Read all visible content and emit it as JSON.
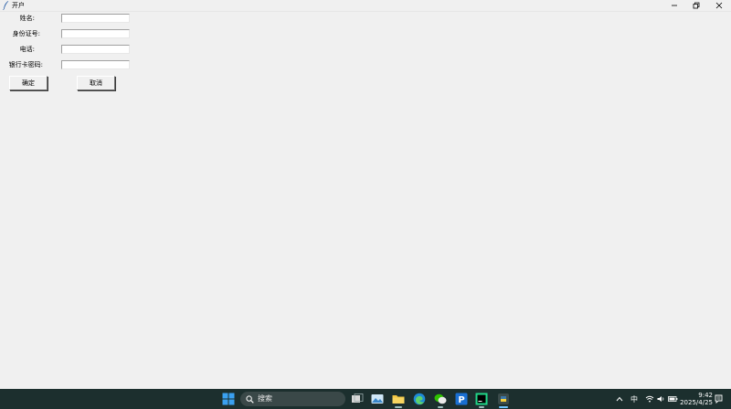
{
  "window": {
    "title": "开户"
  },
  "form": {
    "fields": [
      {
        "label": "姓名:",
        "value": "",
        "placeholder": ""
      },
      {
        "label": "身份证号:",
        "value": "",
        "placeholder": ""
      },
      {
        "label": "电话:",
        "value": "",
        "placeholder": ""
      },
      {
        "label": "银行卡密码:",
        "value": "",
        "placeholder": ""
      }
    ],
    "confirm_label": "确定",
    "cancel_label": "取消"
  },
  "taskbar": {
    "search_placeholder": "搜索",
    "ime_indicator": "中",
    "time": "9:42",
    "date": "2025/4/25",
    "apps": [
      "windows-start",
      "task-view",
      "photos",
      "file-explorer",
      "edge",
      "wechat",
      "p-app",
      "pycharm",
      "python-idle"
    ]
  },
  "colors": {
    "window_bg": "#f0f0f0",
    "taskbar_bg": "#1c2f2e",
    "input_bg": "#ffffff"
  }
}
